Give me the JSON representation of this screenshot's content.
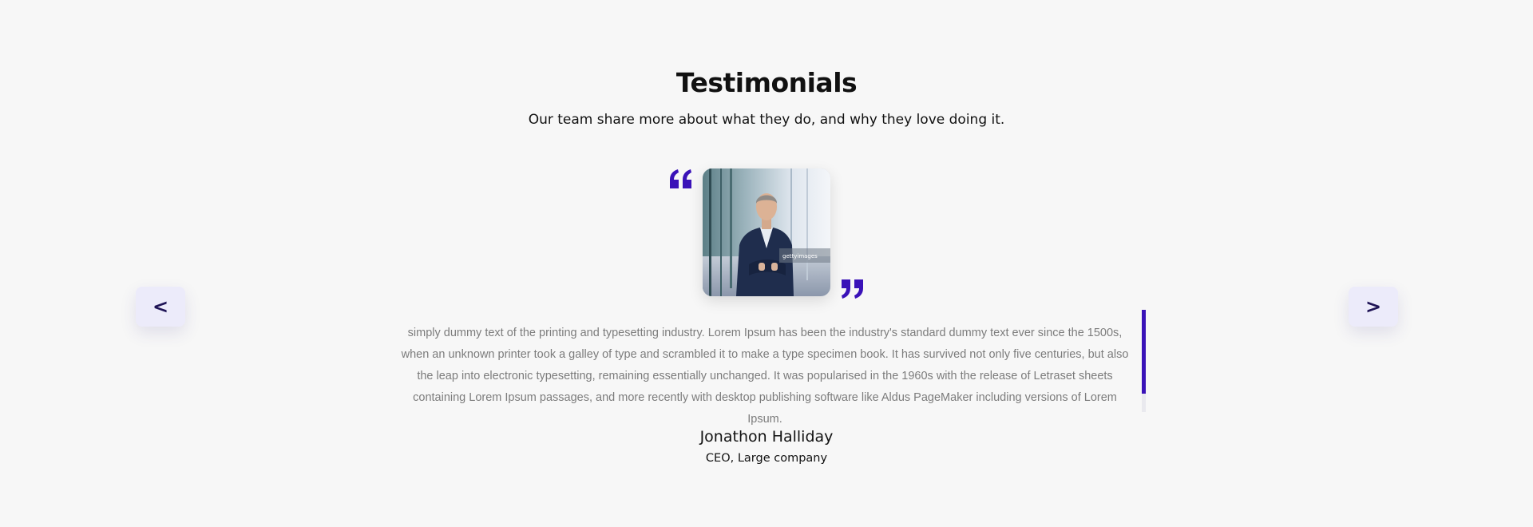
{
  "header": {
    "title": "Testimonials",
    "subtitle": "Our team share more about what they do, and why they love doing it."
  },
  "testimonial": {
    "photo_icon": "person-portrait",
    "body": "simply dummy text of the printing and typesetting industry. Lorem Ipsum has been the industry's standard dummy text ever since the 1500s, when an unknown printer took a galley of type and scrambled it to make a type specimen book. It has survived not only five centuries, but also the leap into electronic typesetting, remaining essentially unchanged. It was popularised in the 1960s with the release of Letraset sheets containing Lorem Ipsum passages, and more recently with desktop publishing software like Aldus PageMaker including versions of Lorem Ipsum.",
    "author_name": "Jonathon Halliday",
    "author_role": "CEO, Large company",
    "scroll_fraction_visible": 0.82
  },
  "navigation": {
    "prev_label": "<",
    "next_label": ">"
  },
  "colors": {
    "accent": "#3a12b8",
    "nav_bg": "#ecebfa",
    "nav_text": "#1f1456",
    "background": "#f7f7f7",
    "body_text": "#7c7c7c"
  },
  "icons": {
    "open_quote": "open-quote-icon",
    "close_quote": "close-quote-icon"
  }
}
